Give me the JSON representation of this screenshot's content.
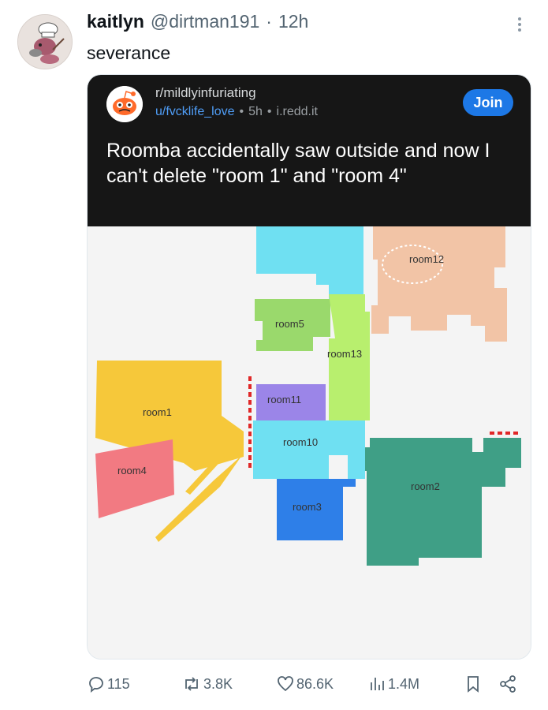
{
  "tweet": {
    "display_name": "kaitlyn",
    "handle": "@dirtman191",
    "separator": "·",
    "time": "12h",
    "text": "severance"
  },
  "reddit": {
    "subreddit": "r/mildlyinfuriating",
    "user": "u/fvcklife_love",
    "sep1": "•",
    "age": "5h",
    "sep2": "•",
    "domain": "i.redd.it",
    "join_label": "Join",
    "title": "Roomba accidentally saw outside and now I can't delete \"room 1\" and \"room 4\""
  },
  "map": {
    "rooms": {
      "room1": "room1",
      "room2": "room2",
      "room3": "room3",
      "room4": "room4",
      "room5": "room5",
      "room10": "room10",
      "room11": "room11",
      "room12": "room12",
      "room13": "room13"
    },
    "colors": {
      "cyan": "#6fe0f2",
      "peach": "#f2c4a6",
      "green": "#9ad96c",
      "lime": "#b8ef6e",
      "yellow": "#f6c83a",
      "pink": "#f27a82",
      "purple": "#9b85e8",
      "teal": "#3f9f86",
      "blue": "#2e7fe8",
      "wall": "#e02828"
    }
  },
  "actions": {
    "replies": "115",
    "reposts": "3.8K",
    "likes": "86.6K",
    "views": "1.4M"
  }
}
